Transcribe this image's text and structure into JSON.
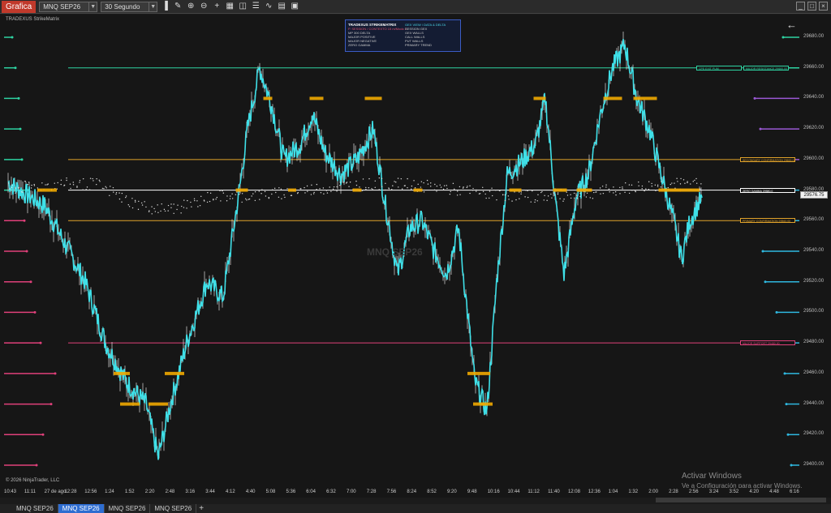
{
  "toolbar": {
    "app_tab": "Grafica",
    "instrument": "MNQ SEP26",
    "interval": "30 Segundo"
  },
  "chart": {
    "indicator_title": "TRADEXUS StrikeMatrix",
    "watermark": "MNQ SEP26",
    "copyright": "© 2026 NinjaTrader, LLC",
    "current_price": "29576.75",
    "price_axis": [
      "29680.00",
      "29660.00",
      "29640.00",
      "29620.00",
      "29600.00",
      "29580.00",
      "29560.00",
      "29540.00",
      "29520.00",
      "29500.00",
      "29480.00",
      "29460.00",
      "29440.00",
      "29420.00",
      "29400.00"
    ],
    "time_axis": [
      "10:43",
      "11:11",
      "27 de ago.",
      "12:28",
      "12:56",
      "1:24",
      "1:52",
      "2:20",
      "2:48",
      "3:16",
      "3:44",
      "4:12",
      "4:40",
      "5:08",
      "5:36",
      "6:04",
      "6:32",
      "7:00",
      "7:28",
      "7:56",
      "8:24",
      "8:52",
      "9:20",
      "9:48",
      "10:16",
      "10:44",
      "11:12",
      "11:40",
      "12:08",
      "12:36",
      "1:04",
      "1:32",
      "2:00",
      "2:28",
      "2:56",
      "3:24",
      "3:52",
      "4:20",
      "4:48",
      "6:16"
    ],
    "levels": [
      {
        "price": 29660,
        "color": "#2ed3a2",
        "labels": [
          "CPE EXIT PUM",
          "MAJOR RESISTANCE 29660.00"
        ]
      },
      {
        "price": 29600,
        "color": "#e0a22a",
        "labels": [
          "SECONDARY CONFIRMATION 29600.00"
        ]
      },
      {
        "price": 29580,
        "color": "#ffffff",
        "labels": [
          "ZERO GAMMA 29580.0"
        ]
      },
      {
        "price": 29560,
        "color": "#e0a22a",
        "labels": [
          "PRIMARY CONFIRMATION 29560.00"
        ]
      },
      {
        "price": 29480,
        "color": "#e0407a",
        "labels": [
          "MAJOR SUPPORT 29480.00"
        ]
      }
    ],
    "colors": {
      "price_line": "#3fe0e8",
      "tick_up": "#ffffff",
      "marker": "#f0a800"
    }
  },
  "panel": {
    "title": "TRADEXUS STRIKEMATRIX",
    "rows": [
      "P. SESSION / CONTEXTO 15 m/Modo 2",
      "MP 300 DELTA",
      "MAJOR POSITIVE",
      "MAJOR NEGATIVE",
      "ZERO GAMMA"
    ],
    "right_title": "GEX VIEW / DATA & DELTA",
    "right_rows": [
      "SESSION GEX",
      "GEX WALLS",
      "CALL WALLS",
      "PUT WALLS",
      "PRIMARY TREND"
    ]
  },
  "windows_notice": {
    "line1": "Activar Windows",
    "line2": "Ve a Configuración para activar Windows."
  },
  "tabs": [
    "MNQ SEP26",
    "MNQ SEP26",
    "MNQ SEP26",
    "MNQ SEP26"
  ]
}
